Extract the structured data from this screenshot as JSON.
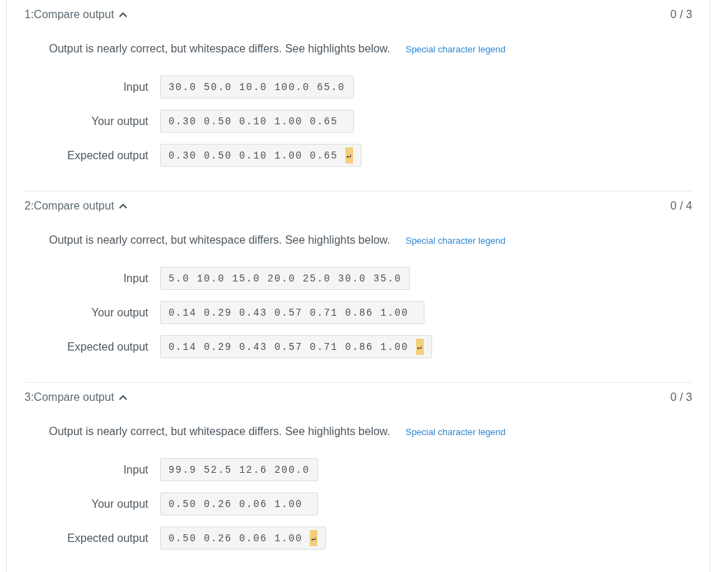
{
  "tests": [
    {
      "title": "1:Compare output",
      "expanded": true,
      "score": "0 / 3",
      "message": "Output is nearly correct, but whitespace differs. See highlights below.",
      "legend_link": "Special character legend",
      "rows": [
        {
          "label": "Input",
          "value": "30.0 50.0 10.0 100.0 65.0"
        },
        {
          "label": "Your output",
          "value": "0.30 0.50 0.10 1.00 0.65 "
        },
        {
          "label": "Expected output",
          "value": "0.30 0.50 0.10 1.00 0.65 ",
          "newline_marker": "↵"
        }
      ]
    },
    {
      "title": "2:Compare output",
      "expanded": true,
      "score": "0 / 4",
      "message": "Output is nearly correct, but whitespace differs. See highlights below.",
      "legend_link": "Special character legend",
      "rows": [
        {
          "label": "Input",
          "value": "5.0 10.0 15.0 20.0 25.0 30.0 35.0"
        },
        {
          "label": "Your output",
          "value": "0.14 0.29 0.43 0.57 0.71 0.86 1.00 "
        },
        {
          "label": "Expected output",
          "value": "0.14 0.29 0.43 0.57 0.71 0.86 1.00 ",
          "newline_marker": "↵"
        }
      ]
    },
    {
      "title": "3:Compare output",
      "expanded": true,
      "score": "0 / 3",
      "message": "Output is nearly correct, but whitespace differs. See highlights below.",
      "legend_link": "Special character legend",
      "rows": [
        {
          "label": "Input",
          "value": "99.9 52.5 12.6 200.0"
        },
        {
          "label": "Your output",
          "value": "0.50 0.26 0.06 1.00 "
        },
        {
          "label": "Expected output",
          "value": "0.50 0.26 0.06 1.00 ",
          "newline_marker": "↵"
        }
      ]
    }
  ]
}
